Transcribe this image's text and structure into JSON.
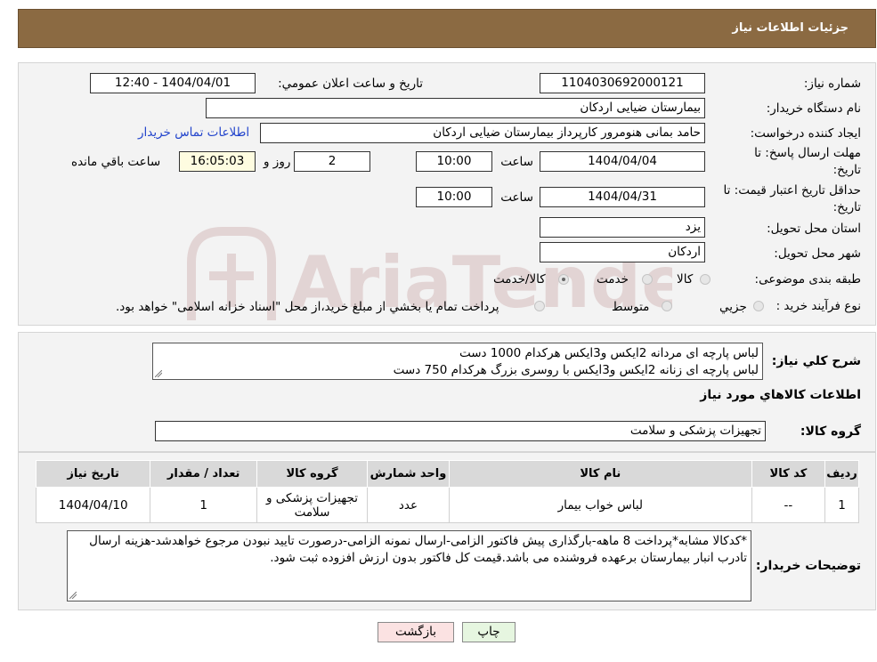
{
  "header": {
    "title": "جزئیات اطلاعات نیاز"
  },
  "form": {
    "need_number_label": "شماره نیاز:",
    "need_number": "1104030692000121",
    "announce_label": "تاریخ و ساعت اعلان عمومي:",
    "announce_value": "1404/04/01 - 12:40",
    "buyer_org_label": "نام دستگاه خريدار:",
    "buyer_org": "بیمارستان ضیایی اردکان",
    "creator_label": "ايجاد کننده درخواست:",
    "creator": "حامد بمانی هنومرور کارپرداز بیمارستان ضیایی اردکان",
    "contact_link": "اطلاعات تماس خريدار",
    "deadline_label_1": "مهلت ارسال پاسخ: تا",
    "deadline_label_2": "تاریخ:",
    "deadline_date": "1404/04/04",
    "time_label": "ساعت",
    "deadline_time": "10:00",
    "days_value": "2",
    "days_label": "روز و",
    "remaining_time": "16:05:03",
    "remaining_label": "ساعت باقي مانده",
    "validity_label_1": "حداقل تاريخ اعتبار قيمت: تا",
    "validity_label_2": "تاريخ:",
    "validity_date": "1404/04/31",
    "validity_time_label": "ساعت",
    "validity_time": "10:00",
    "province_label": "استان محل تحويل:",
    "province": "یزد",
    "city_label": "شهر محل تحويل:",
    "city": "اردکان",
    "category_label": "طبقه بندی موضوعی:",
    "category_options": [
      "کالا",
      "خدمت",
      "کالا/خدمت"
    ],
    "process_label": "نوع فرآیند خرید :",
    "process_options": [
      "جزيي",
      "متوسط"
    ],
    "process_note": "پرداخت تمام يا بخشي از مبلغ خريد،از محل \"اسناد خزانه اسلامی\" خواهد بود."
  },
  "watermark": {
    "text": "AriaTender.neT"
  },
  "summary": {
    "label": "شرح کلي نياز:",
    "line1": "لباس پارچه ای مردانه 2ایکس و3ایکس   هرکدام 1000 دست",
    "line2": "لباس پارچه ای زنانه 2ایکس و3ایکس با روسری بزرگ   هرکدام 750 دست",
    "goods_info_title": "اطلاعات کالاهاي مورد نياز",
    "group_label": "گروه کالا:",
    "group_value": "تجهيزات پزشکی و سلامت"
  },
  "table": {
    "headers": [
      "رديف",
      "کد کالا",
      "نام کالا",
      "واحد شمارش",
      "گروه کالا",
      "تعداد / مقدار",
      "تاريخ نياز"
    ],
    "rows": [
      [
        "1",
        "--",
        "لباس خواب بیمار",
        "عدد",
        "تجهيزات پزشکی و سلامت",
        "1",
        "1404/04/10"
      ]
    ]
  },
  "buyer_notes": {
    "label": "توضيحات خريدار:",
    "text": "*کدکالا مشابه*پرداخت 8 ماهه-بارگذاری پیش فاکتور الزامی-ارسال نمونه الزامی-درصورت تایید نبودن مرجوع خواهدشد-هزینه ارسال تادرب انبار بیمارستان برعهده فروشنده می باشد.قیمت کل فاکتور بدون ارزش افزوده ثبت شود."
  },
  "buttons": {
    "print": "چاپ",
    "back": "بازگشت"
  }
}
